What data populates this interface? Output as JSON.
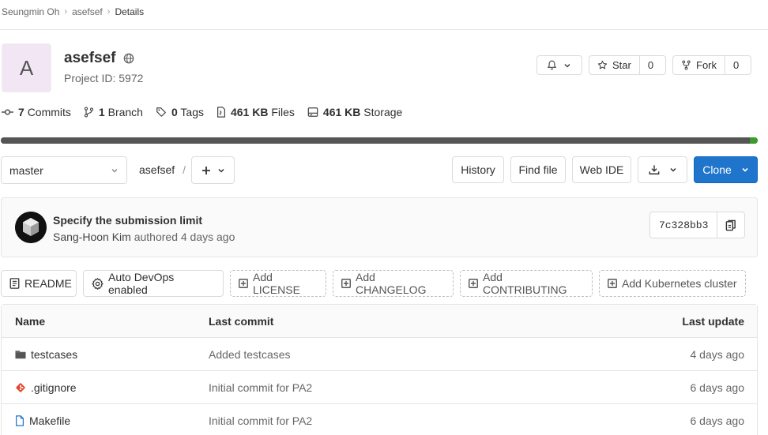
{
  "breadcrumb": {
    "owner": "Seungmin Oh",
    "project": "asefsef",
    "current": "Details"
  },
  "project": {
    "avatar_letter": "A",
    "name": "asefsef",
    "id_text": "Project ID: 5972"
  },
  "actions": {
    "star_label": "Star",
    "star_count": "0",
    "fork_label": "Fork",
    "fork_count": "0"
  },
  "stats": {
    "commits_count": "7",
    "commits_label": "Commits",
    "branches_count": "1",
    "branches_label": "Branch",
    "tags_count": "0",
    "tags_label": "Tags",
    "files_size": "461 KB",
    "files_label": "Files",
    "storage_size": "461 KB",
    "storage_label": "Storage"
  },
  "languages": [
    {
      "fraction": 0.99,
      "color": "#555555"
    },
    {
      "fraction": 0.01,
      "color": "#3d9a2c"
    }
  ],
  "repo": {
    "branch": "master",
    "path_root": "asefsef",
    "path_sep": "/",
    "history": "History",
    "find_file": "Find file",
    "web_ide": "Web IDE",
    "clone": "Clone"
  },
  "commit": {
    "title": "Specify the submission limit",
    "author": "Sang-Hoon Kim",
    "meta": "authored 4 days ago",
    "sha": "7c328bb3"
  },
  "quick_actions": {
    "readme": "README",
    "autodevops": "Auto DevOps enabled",
    "license": "Add LICENSE",
    "changelog": "Add CHANGELOG",
    "contributing": "Add CONTRIBUTING",
    "kubernetes": "Add Kubernetes cluster"
  },
  "files": {
    "headers": {
      "name": "Name",
      "last_commit": "Last commit",
      "last_update": "Last update"
    },
    "rows": [
      {
        "icon": "folder-icon",
        "name": "testcases",
        "commit": "Added testcases",
        "updated": "4 days ago"
      },
      {
        "icon": "git-icon",
        "name": ".gitignore",
        "commit": "Initial commit for PA2",
        "updated": "6 days ago"
      },
      {
        "icon": "file-icon",
        "name": "Makefile",
        "commit": "Initial commit for PA2",
        "updated": "6 days ago"
      }
    ]
  }
}
